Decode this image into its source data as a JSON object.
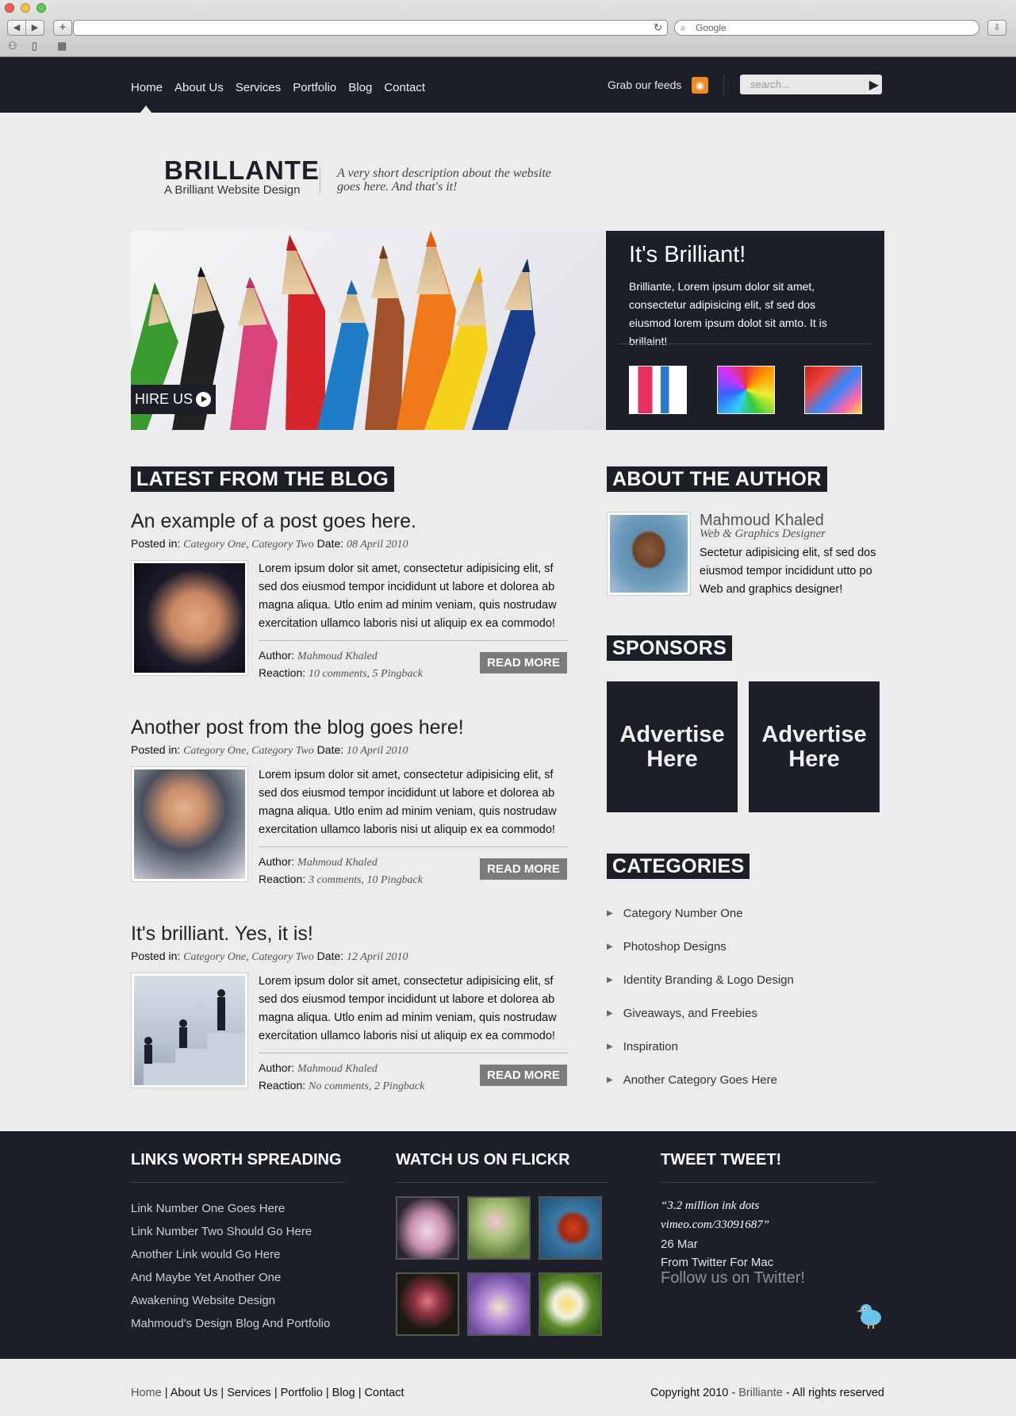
{
  "browser": {
    "search_placeholder": "Google",
    "nav_back": "◀",
    "nav_forward": "▶",
    "add": "+",
    "reload": "↻",
    "download": "⇩"
  },
  "nav": {
    "links": [
      "Home",
      "About Us",
      "Services",
      "Portfolio",
      "Blog",
      "Contact"
    ],
    "feeds_label": "Grab our feeds",
    "search_placeholder": "search..."
  },
  "header": {
    "brand": "BRILLANTE",
    "tagline": "A Brilliant Website Design",
    "description": "A very short description about the website goes here. And that's it!"
  },
  "hero": {
    "cta": "HIRE US",
    "feature_title": "It's Brilliant!",
    "feature_text": "Brilliante, Lorem ipsum dolor sit amet, consectetur adipisicing elit, sf sed dos eiusmod lorem ipsum dolot sit amto. It is brillaint!"
  },
  "blog": {
    "heading": "LATEST FROM THE BLOG",
    "posted_in_label": "Posted in:",
    "date_label": "Date:",
    "author_label": "Author:",
    "reaction_label": "Reaction:",
    "read_more": "READ MORE",
    "posts": [
      {
        "title": "An example of a post goes here.",
        "categories": "Category One, Category Two",
        "date": "08 April 2010",
        "excerpt": "Lorem ipsum dolor sit amet, consectetur adipisicing elit, sf sed dos eiusmod tempor incididunt ut labore et dolorea ab magna aliqua. Utlo enim ad minim veniam, quis nostrudaw exercitation ullamco laboris nisi ut aliquip ex ea commodo!",
        "author": "Mahmoud Khaled",
        "reaction": "10 comments, 5 Pingback"
      },
      {
        "title": "Another post from the blog goes here!",
        "categories": "Category One, Category Two",
        "date": "10 April 2010",
        "excerpt": "Lorem ipsum dolor sit amet, consectetur adipisicing elit, sf sed dos eiusmod tempor incididunt ut labore et dolorea ab magna aliqua. Utlo enim ad minim veniam, quis nostrudaw exercitation ullamco laboris nisi ut aliquip ex ea commodo!",
        "author": "Mahmoud Khaled",
        "reaction": "3 comments, 10 Pingback"
      },
      {
        "title": "It's brilliant. Yes, it is!",
        "categories": "Category One, Category Two",
        "date": "12 April 2010",
        "excerpt": "Lorem ipsum dolor sit amet, consectetur adipisicing elit, sf sed dos eiusmod tempor incididunt ut labore et dolorea ab magna aliqua. Utlo enim ad minim veniam, quis nostrudaw exercitation ullamco laboris nisi ut aliquip ex ea commodo!",
        "author": "Mahmoud Khaled",
        "reaction": "No comments, 2 Pingback"
      }
    ]
  },
  "author": {
    "heading": "ABOUT THE AUTHOR",
    "name": "Mahmoud Khaled",
    "role": "Web & Graphics Designer",
    "bio": "Sectetur adipisicing elit, sf sed dos eiusmod tempor incididunt utto po Web and graphics designer!"
  },
  "sponsors": {
    "heading": "SPONSORS",
    "ads": [
      "Advertise Here",
      "Advertise Here"
    ]
  },
  "categories": {
    "heading": "CATEGORIES",
    "items": [
      "Category Number One",
      "Photoshop Designs",
      "Identity Branding & Logo Design",
      "Giveaways, and Freebies",
      "Inspiration",
      "Another Category Goes Here"
    ]
  },
  "footer": {
    "links_heading": "LINKS WORTH SPREADING",
    "links": [
      "Link Number One Goes Here",
      "Link Number Two Should Go Here",
      "Another Link would Go Here",
      "And Maybe Yet Another One",
      "Awakening Website Design",
      "Mahmoud's Design Blog And Portfolio"
    ],
    "flickr_heading": "WATCH US ON FLICKR",
    "tweet_heading": "TWEET TWEET!",
    "tweet_line1": "“3.2 million ink dots",
    "tweet_line2": "vimeo.com/33091687”",
    "tweet_date": "26 Mar",
    "tweet_source": "From Twitter For Mac",
    "follow": "Follow us on Twitter!"
  },
  "bottom": {
    "links": [
      "Home",
      "About Us",
      "Services",
      "Portfolio",
      "Blog",
      "Contact"
    ],
    "copyright_prefix": "Copyright 2010 -",
    "copyright_brand": "Brilliante",
    "copyright_suffix": "- All rights reserved"
  },
  "colors": {
    "dark": "#1c1f27",
    "background": "#ececec",
    "rss": "#f08a24",
    "read_more": "#7b7b7b"
  }
}
